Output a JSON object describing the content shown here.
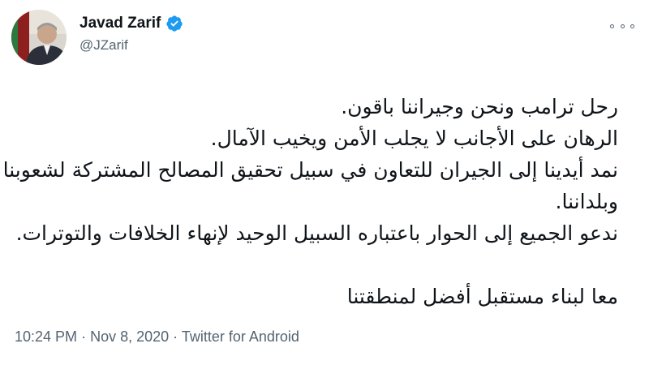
{
  "author": {
    "display_name": "Javad Zarif",
    "handle": "@JZarif",
    "verified": true,
    "avatar": "profile-photo"
  },
  "tweet": {
    "lines": [
      "رحل ترامب ونحن وجيراننا باقون.",
      "الرهان على الأجانب لا يجلب الأمن ويخيب الآمال.",
      "نمد أيدينا إلى الجيران للتعاون في سبيل تحقيق المصالح المشتركة لشعوبنا",
      "وبلداننا.",
      "ندعو الجميع إلى الحوار باعتباره السبيل الوحيد لإنهاء الخلافات والتوترات.",
      "",
      "معا لبناء مستقبل أفضل لمنطقتنا"
    ]
  },
  "meta": {
    "time": "10:24 PM",
    "separator": "·",
    "date": "Nov 8, 2020",
    "source": "Twitter for Android"
  },
  "icons": {
    "verified": "verified-badge-icon",
    "more": "more-options-icon"
  },
  "colors": {
    "verified_blue": "#1d9bf0",
    "secondary_text": "#536471",
    "primary_text": "#0f1419"
  }
}
